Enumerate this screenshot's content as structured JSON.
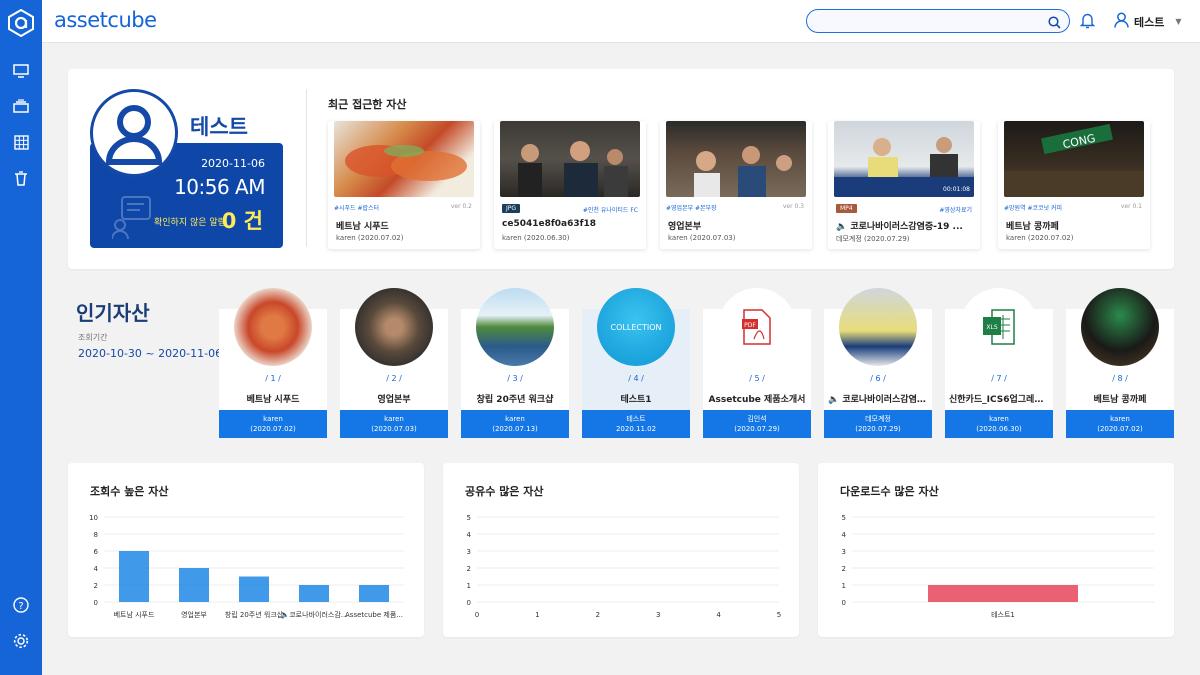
{
  "brand": {
    "name": "assetcube"
  },
  "header": {
    "search_placeholder": "",
    "user_name": "테스트"
  },
  "profile": {
    "name": "테스트",
    "date": "2020-11-06",
    "time": "10:56 AM",
    "notice_label": "확인하지 않은 알림",
    "notice_count": "0 건"
  },
  "recent": {
    "title": "최근 접근한 자산",
    "items": [
      {
        "tags": "#시푸드 #랍스터",
        "version": "ver 0.2",
        "name": "베트남 시푸드",
        "meta": "karen (2020.07.02)"
      },
      {
        "badge": "JPG",
        "tags": "#인천 유나이티드 FC",
        "name": "ce5041e8f0a63f18",
        "meta": "karen (2020.06.30)"
      },
      {
        "tags": "#영업본부 #본부장",
        "version": "ver 0.3",
        "name": "영업본부",
        "meta": "karen (2020.07.03)"
      },
      {
        "badge": "MP4",
        "tags": "#영상자료기",
        "name": "🔈 코로나바이러스감염증-19 ...",
        "meta": "데모계정 (2020.07.29)",
        "video_time": "00:01:08"
      },
      {
        "tags": "#망원역 #코코넛 커피",
        "version": "ver 0.1",
        "name": "베트남 콩까페",
        "meta": "karen (2020.07.02)"
      }
    ]
  },
  "popular": {
    "title": "인기자산",
    "period_label": "조회기간",
    "period": "2020-10-30 ~ 2020-11-06",
    "items": [
      {
        "rank": "/ 1 /",
        "name": "베트남 시푸드",
        "user": "karen",
        "date": "(2020.07.02)"
      },
      {
        "rank": "/ 2 /",
        "name": "영업본부",
        "user": "karen",
        "date": "(2020.07.03)"
      },
      {
        "rank": "/ 3 /",
        "name": "창립 20주년 워크샵",
        "user": "karen",
        "date": "(2020.07.13)"
      },
      {
        "rank": "/ 4 /",
        "name": "테스트1",
        "user": "테스트",
        "date": "2020.11.02",
        "circle_label": "COLLECTION"
      },
      {
        "rank": "/ 5 /",
        "name": "Assetcube 제품소개서",
        "user": "김인석",
        "date": "(2020.07.29)"
      },
      {
        "rank": "/ 6 /",
        "name": "🔈 코로나바이러스감염증-...",
        "user": "데모계정",
        "date": "(2020.07.29)"
      },
      {
        "rank": "/ 7 /",
        "name": "신한카드_ICS6업그레이드...",
        "user": "karen",
        "date": "(2020.06.30)"
      },
      {
        "rank": "/ 8 /",
        "name": "베트남 콩까페",
        "user": "karen",
        "date": "(2020.07.02)"
      }
    ]
  },
  "stats": {
    "views_title": "조회수 높은 자산",
    "shares_title": "공유수 많은 자산",
    "downloads_title": "다운로드수 많은 자산"
  },
  "chart_data": [
    {
      "type": "bar",
      "title": "조회수 높은 자산",
      "categories": [
        "베트남 시푸드",
        "영업본부",
        "창립 20주년 워크샵",
        "🔈코로나바이러스감...",
        "Assetcube 제품..."
      ],
      "values": [
        6,
        4,
        3,
        2,
        2
      ],
      "ylim": [
        0,
        10
      ],
      "yticks": [
        0,
        2,
        4,
        6,
        8,
        10
      ],
      "color": "#1e88e5"
    },
    {
      "type": "bar",
      "title": "공유수 많은 자산",
      "categories": [],
      "values": [],
      "ylim": [
        0,
        5
      ],
      "yticks": [
        0,
        1,
        2,
        3,
        4,
        5
      ],
      "xticks": [
        0,
        1,
        2,
        3,
        4,
        5
      ]
    },
    {
      "type": "bar",
      "orientation": "horizontal",
      "title": "다운로드수 많은 자산",
      "categories": [
        "테스트1"
      ],
      "values": [
        1
      ],
      "ylim": [
        0,
        5
      ],
      "yticks": [
        0,
        1,
        2,
        3,
        4,
        5
      ],
      "color": "#e8455c"
    }
  ],
  "colors": {
    "primary": "#1565d8",
    "panel": "#0f47a8",
    "accent": "#ffeb5a"
  }
}
